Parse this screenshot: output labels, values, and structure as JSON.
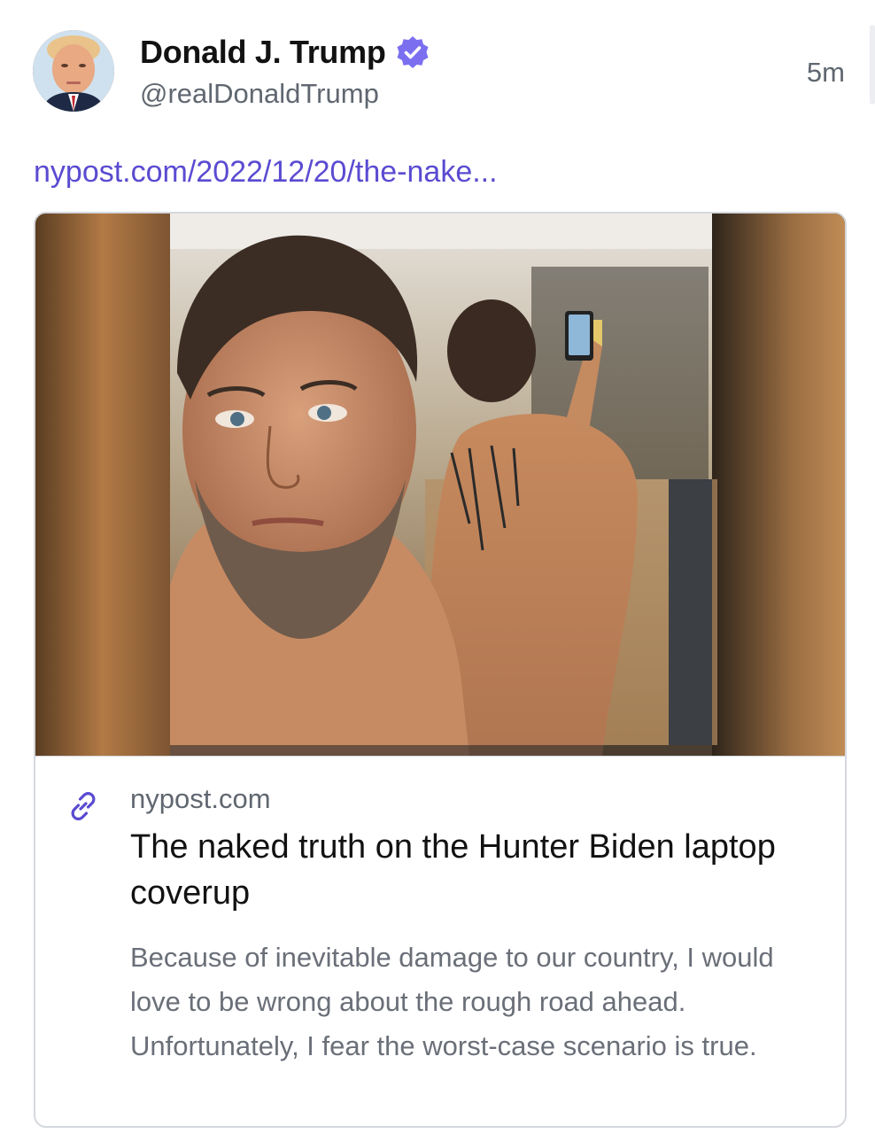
{
  "author": {
    "display_name": "Donald J. Trump",
    "handle": "@realDonaldTrump",
    "verified": true,
    "avatar_icon": "avatar-portrait"
  },
  "timestamp": "5m",
  "post": {
    "link_text": "nypost.com/2022/12/20/the-nake..."
  },
  "link_card": {
    "domain": "nypost.com",
    "title": "The naked truth on the Hunter Biden laptop coverup",
    "description": "Because of inevitable damage to our country, I would love to be wrong about the rough road ahead. Unfortunately, I fear the worst-case scenario is true.",
    "icon": "link-icon"
  },
  "colors": {
    "link": "#5a4bd1",
    "verified": "#7b6ff0",
    "muted_text": "#606770",
    "primary_text": "#121212"
  }
}
